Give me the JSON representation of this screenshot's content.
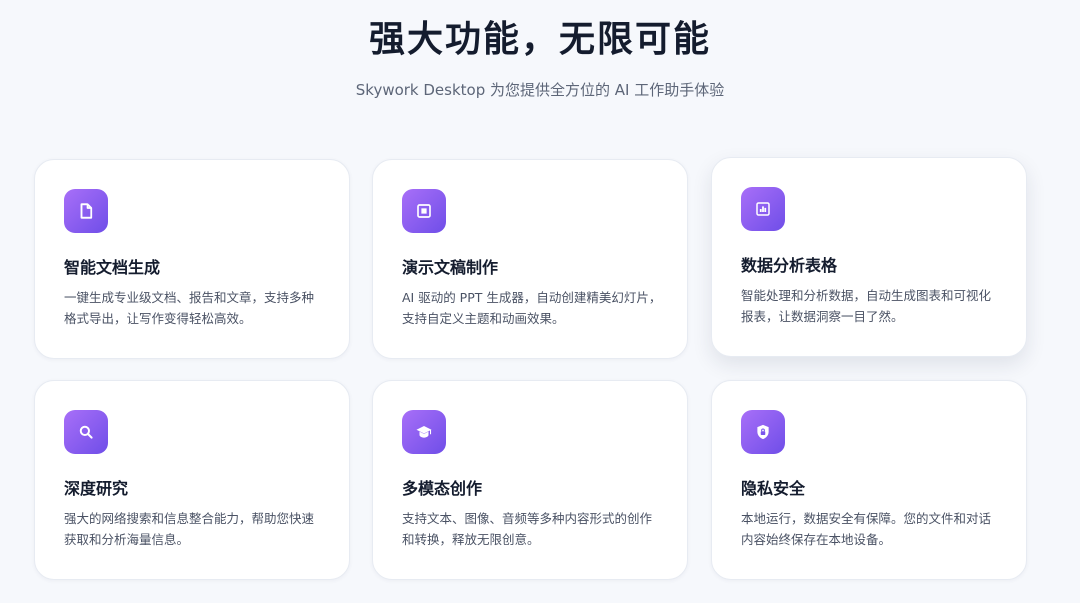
{
  "header": {
    "title": "强大功能，无限可能",
    "subtitle": "Skywork Desktop 为您提供全方位的 AI 工作助手体验"
  },
  "theme": {
    "icon_gradient_start": "#a86ff8",
    "icon_gradient_end": "#6f4ee8",
    "background": "#f6f8fc"
  },
  "features": [
    {
      "icon": "document-icon",
      "title": "智能文档生成",
      "description": "一键生成专业级文档、报告和文章，支持多种格式导出，让写作变得轻松高效。"
    },
    {
      "icon": "presentation-icon",
      "title": "演示文稿制作",
      "description": "AI 驱动的 PPT 生成器，自动创建精美幻灯片，支持自定义主题和动画效果。"
    },
    {
      "icon": "chart-icon",
      "title": "数据分析表格",
      "description": "智能处理和分析数据，自动生成图表和可视化报表，让数据洞察一目了然。"
    },
    {
      "icon": "search-icon",
      "title": "深度研究",
      "description": "强大的网络搜索和信息整合能力，帮助您快速获取和分析海量信息。"
    },
    {
      "icon": "graduation-cap-icon",
      "title": "多模态创作",
      "description": "支持文本、图像、音频等多种内容形式的创作和转换，释放无限创意。"
    },
    {
      "icon": "shield-lock-icon",
      "title": "隐私安全",
      "description": "本地运行，数据安全有保障。您的文件和对话内容始终保存在本地设备。"
    }
  ]
}
